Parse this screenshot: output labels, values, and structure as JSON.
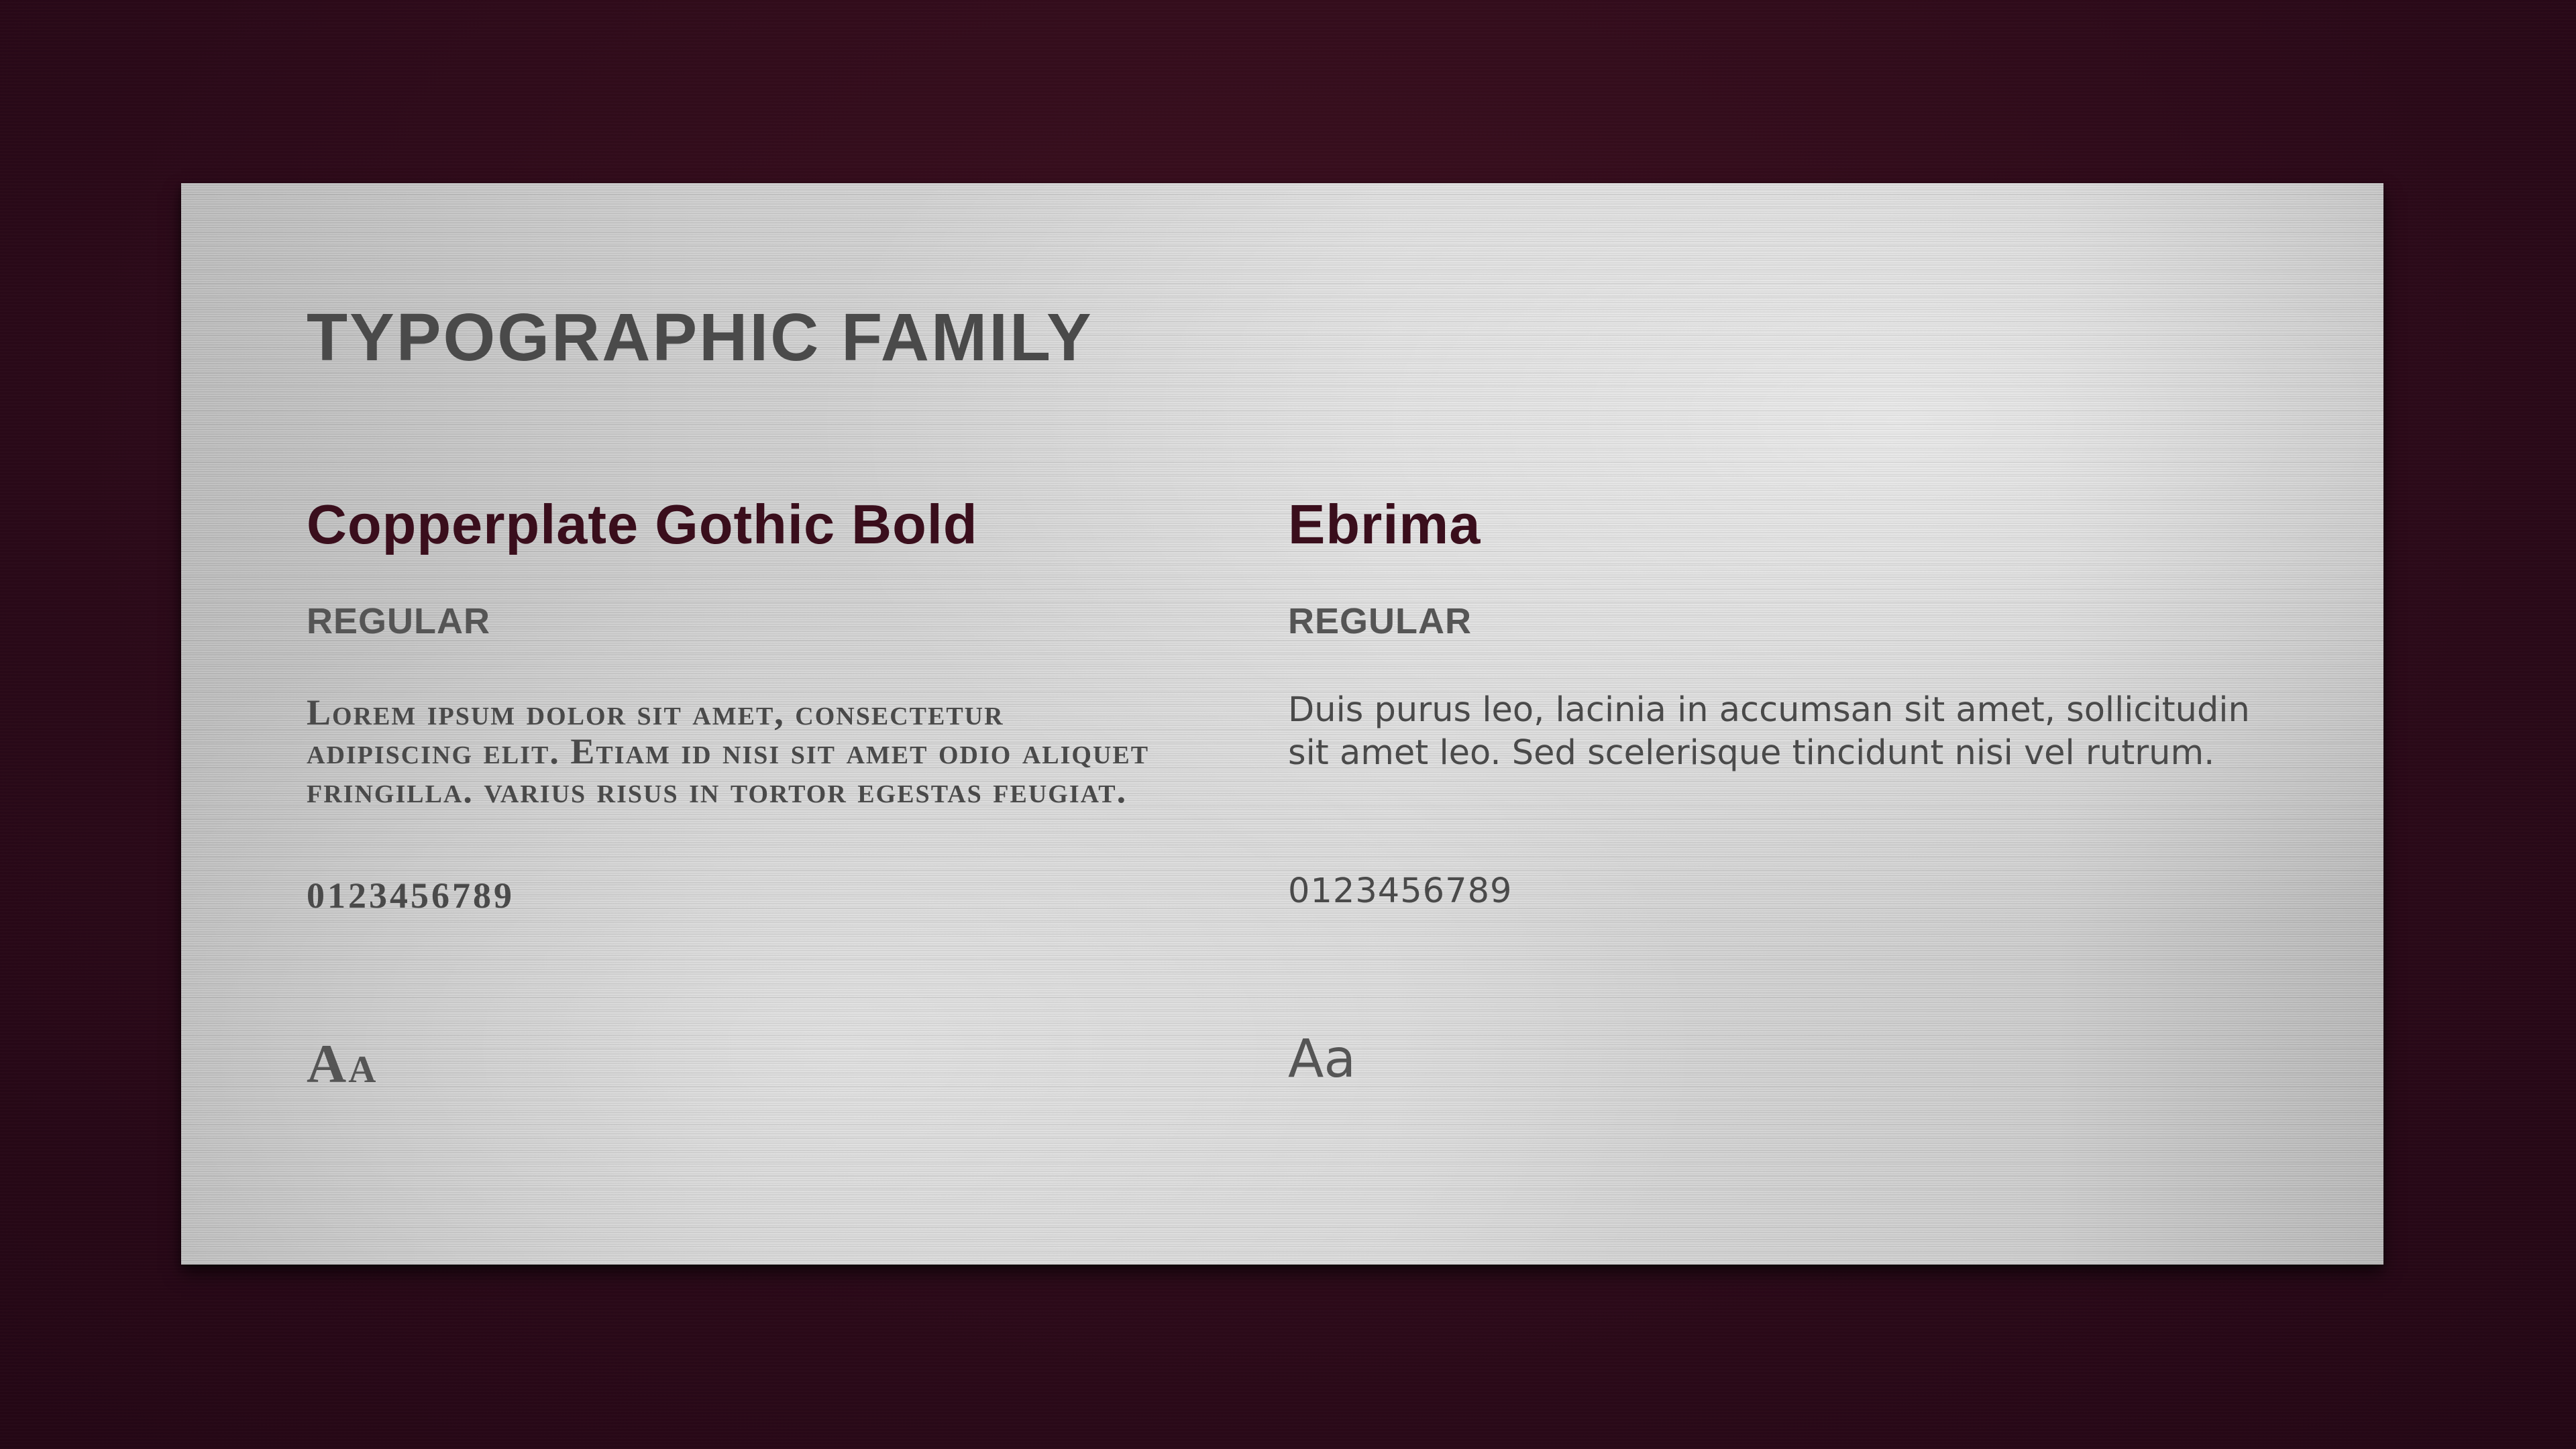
{
  "slide": {
    "title": "TYPOGRAPHIC FAMILY"
  },
  "fonts": [
    {
      "name": "Copperplate Gothic Bold",
      "weight": "REGULAR",
      "sample": "Lorem ipsum dolor sit amet, consectetur adipiscing elit. Etiam id nisi sit amet odio aliquet fringilla. varius risus in tortor egestas feugiat.",
      "digits": "0123456789",
      "glyph": "Aa"
    },
    {
      "name": "Ebrima",
      "weight": "REGULAR",
      "sample": "Duis purus leo, lacinia in accumsan sit amet, sollicitudin sit amet leo. Sed scelerisque tincidunt nisi vel rutrum.",
      "digits": "0123456789",
      "glyph": "Aa"
    }
  ],
  "colors": {
    "background": "#2f0b1b",
    "panel": "#d2d2d2",
    "accent": "#3a0e1c",
    "text": "#4a4a4a"
  }
}
